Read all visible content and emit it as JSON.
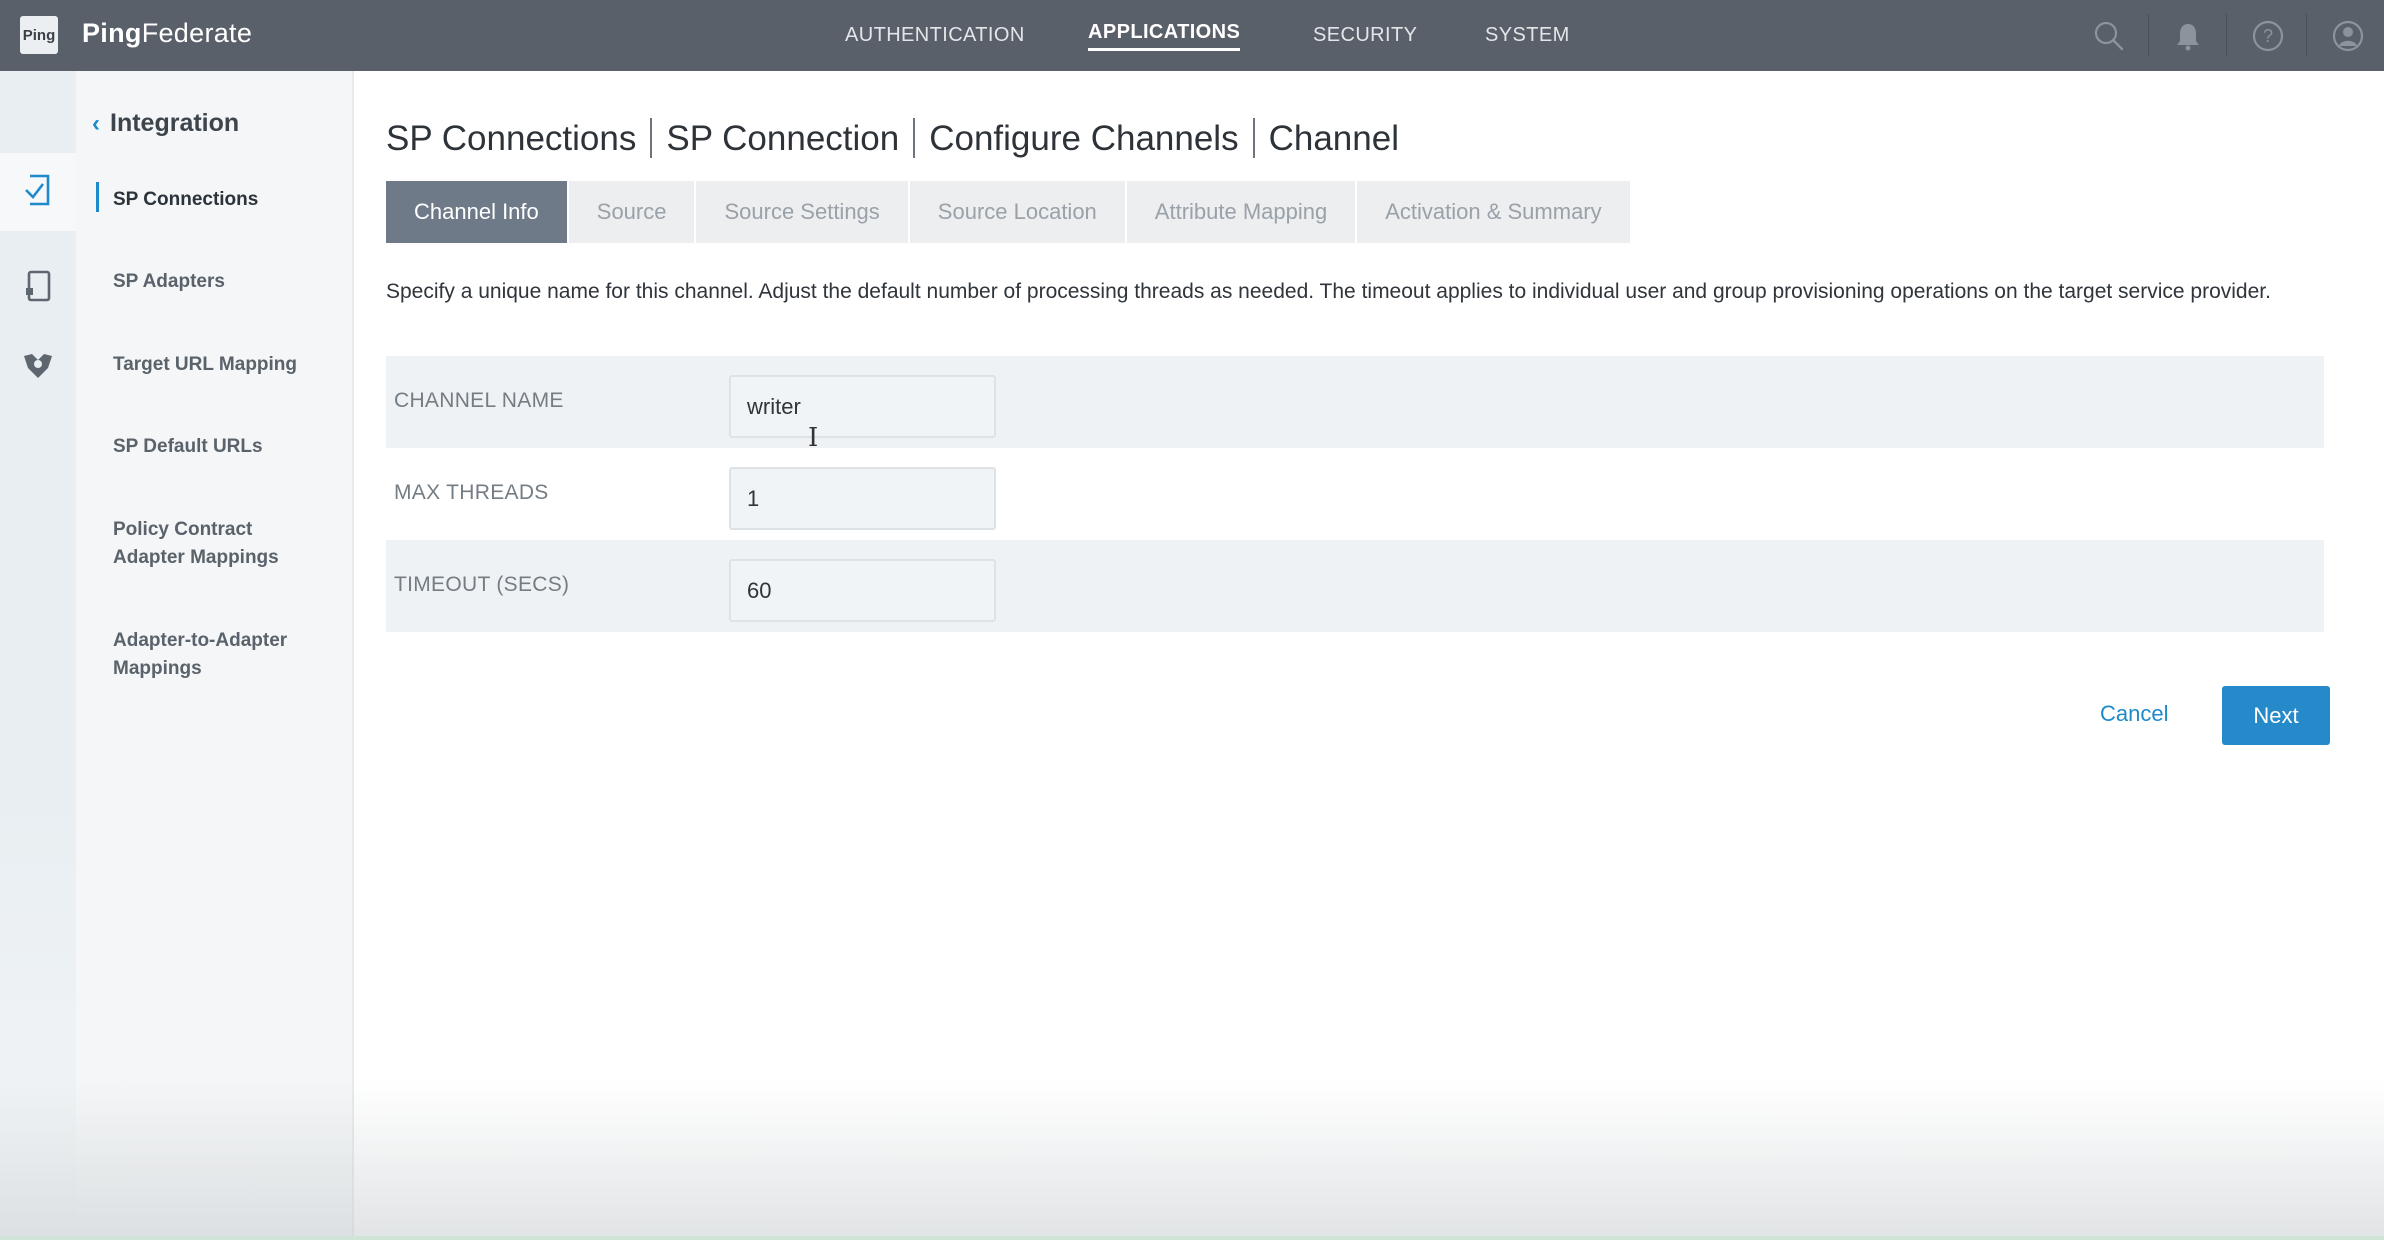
{
  "app": {
    "logo_text": "Ping",
    "brand_bold": "Ping",
    "brand_rest": "Federate"
  },
  "topnav": {
    "items": [
      {
        "label": "AUTHENTICATION",
        "active": false
      },
      {
        "label": "APPLICATIONS",
        "active": true
      },
      {
        "label": "SECURITY",
        "active": false
      },
      {
        "label": "SYSTEM",
        "active": false
      }
    ],
    "icons": [
      "search-icon",
      "bell-icon",
      "help-icon",
      "user-icon"
    ]
  },
  "rail": {
    "icons": [
      "sp-connections-icon",
      "sp-adapters-icon",
      "target-mapping-icon"
    ]
  },
  "sidebar": {
    "back_label": "Integration",
    "items": [
      {
        "label": "SP Connections",
        "active": true
      },
      {
        "label": "SP Adapters",
        "active": false
      },
      {
        "label": "Target URL Mapping",
        "active": false
      },
      {
        "label": "SP Default URLs",
        "active": false
      },
      {
        "label": "Policy Contract Adapter Mappings",
        "active": false
      },
      {
        "label": "Adapter-to-Adapter Mappings",
        "active": false
      }
    ]
  },
  "breadcrumb": [
    "SP Connections",
    "SP Connection",
    "Configure Channels",
    "Channel"
  ],
  "tabs": [
    {
      "label": "Channel Info",
      "active": true
    },
    {
      "label": "Source",
      "active": false
    },
    {
      "label": "Source Settings",
      "active": false
    },
    {
      "label": "Source Location",
      "active": false
    },
    {
      "label": "Attribute Mapping",
      "active": false
    },
    {
      "label": "Activation & Summary",
      "active": false
    }
  ],
  "description": "Specify a unique name for this channel. Adjust the default number of processing threads as needed. The timeout applies to individual user and group provisioning operations on the target service provider.",
  "form": {
    "channel_name": {
      "label": "CHANNEL NAME",
      "value": "writer"
    },
    "max_threads": {
      "label": "MAX THREADS",
      "value": "1"
    },
    "timeout": {
      "label": "TIMEOUT (SECS)",
      "value": "60"
    }
  },
  "actions": {
    "cancel": "Cancel",
    "next": "Next"
  },
  "colors": {
    "topbar": "#5a6069",
    "accent": "#2689c9",
    "active_tab": "#6e7a88"
  }
}
